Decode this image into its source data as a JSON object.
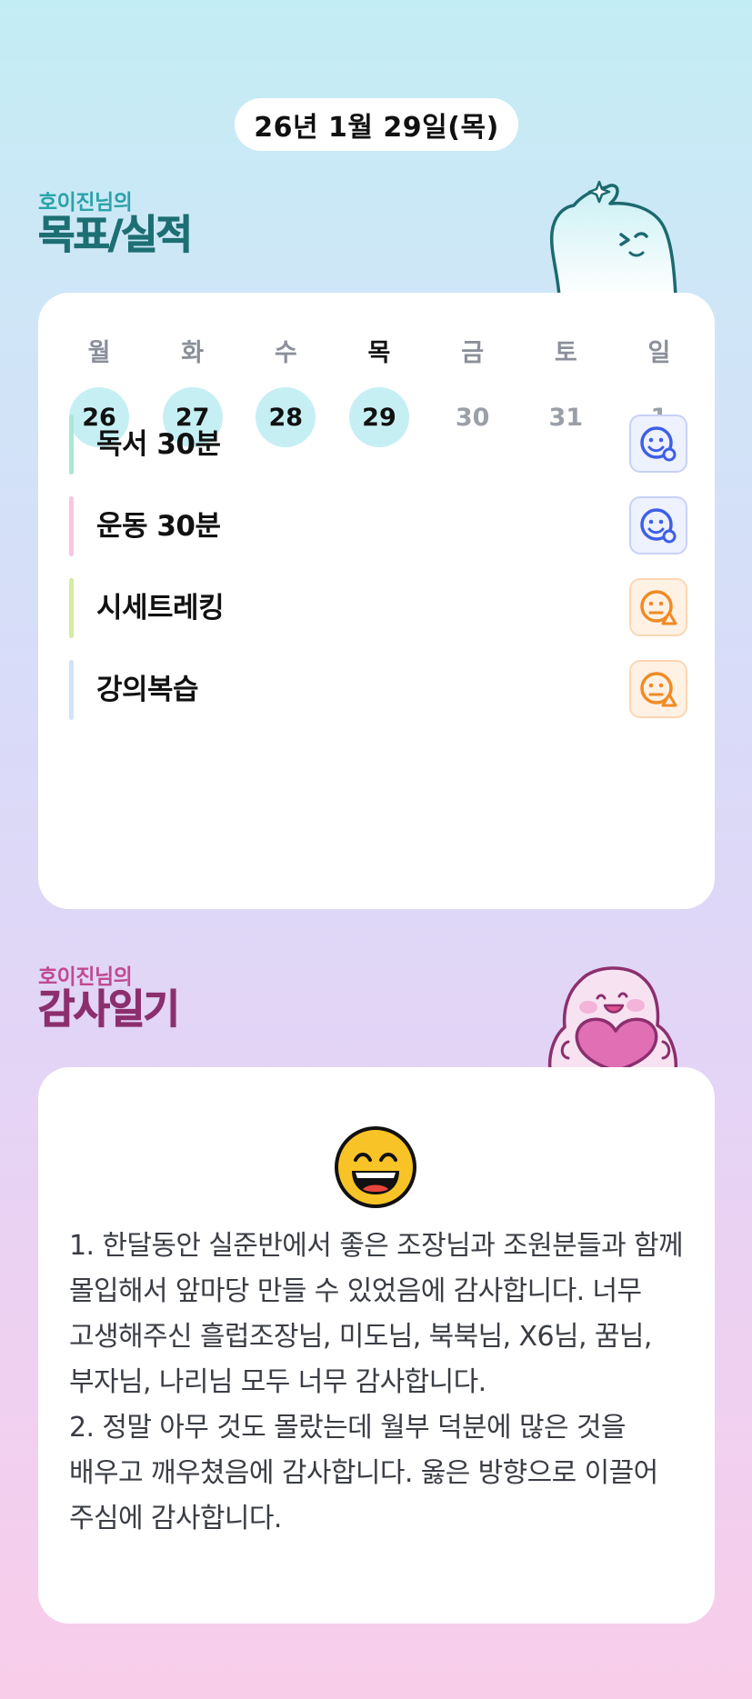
{
  "date_label": "26년 1월 29일(목)",
  "goals_section": {
    "owner": "호이진님의",
    "title": "목표/실적",
    "accent_color": "#1d6f73"
  },
  "week": [
    {
      "name": "월",
      "num": "26",
      "filled": true,
      "today": false
    },
    {
      "name": "화",
      "num": "27",
      "filled": true,
      "today": false
    },
    {
      "name": "수",
      "num": "28",
      "filled": true,
      "today": false
    },
    {
      "name": "목",
      "num": "29",
      "filled": true,
      "today": true
    },
    {
      "name": "금",
      "num": "30",
      "filled": false,
      "today": false
    },
    {
      "name": "토",
      "num": "31",
      "filled": false,
      "today": false
    },
    {
      "name": "일",
      "num": "1",
      "filled": false,
      "today": false
    }
  ],
  "goals": [
    {
      "label": "독서 30분",
      "bar_color": "#a8e8d4",
      "status": "smile-check-icon"
    },
    {
      "label": "운동 30분",
      "bar_color": "#f8c6e2",
      "status": "smile-check-icon"
    },
    {
      "label": "시세트레킹",
      "bar_color": "#d2eca2",
      "status": "meh-triangle-icon"
    },
    {
      "label": "강의복습",
      "bar_color": "#d2e2fa",
      "status": "meh-triangle-icon"
    }
  ],
  "thanks_section": {
    "owner": "호이진님의",
    "title": "감사일기",
    "accent_color": "#8c2f6e",
    "emoji": "grinning-face-icon",
    "lines": [
      "1. 한달동안 실준반에서 좋은 조장님과 조원분들과 함께 몰입해서 앞마당 만들 수 있었음에 감사합니다. 너무 고생해주신 흘럽조장님, 미도님, 북북님, X6님, 꿈님, 부자님, 나리님 모두 너무 감사합니다.",
      "2. 정말 아무 것도 몰랐는데 월부 덕분에 많은 것을 배우고 깨우쳤음에 감사합니다. 옳은 방향으로 이끌어 주심에 감사합니다."
    ]
  }
}
